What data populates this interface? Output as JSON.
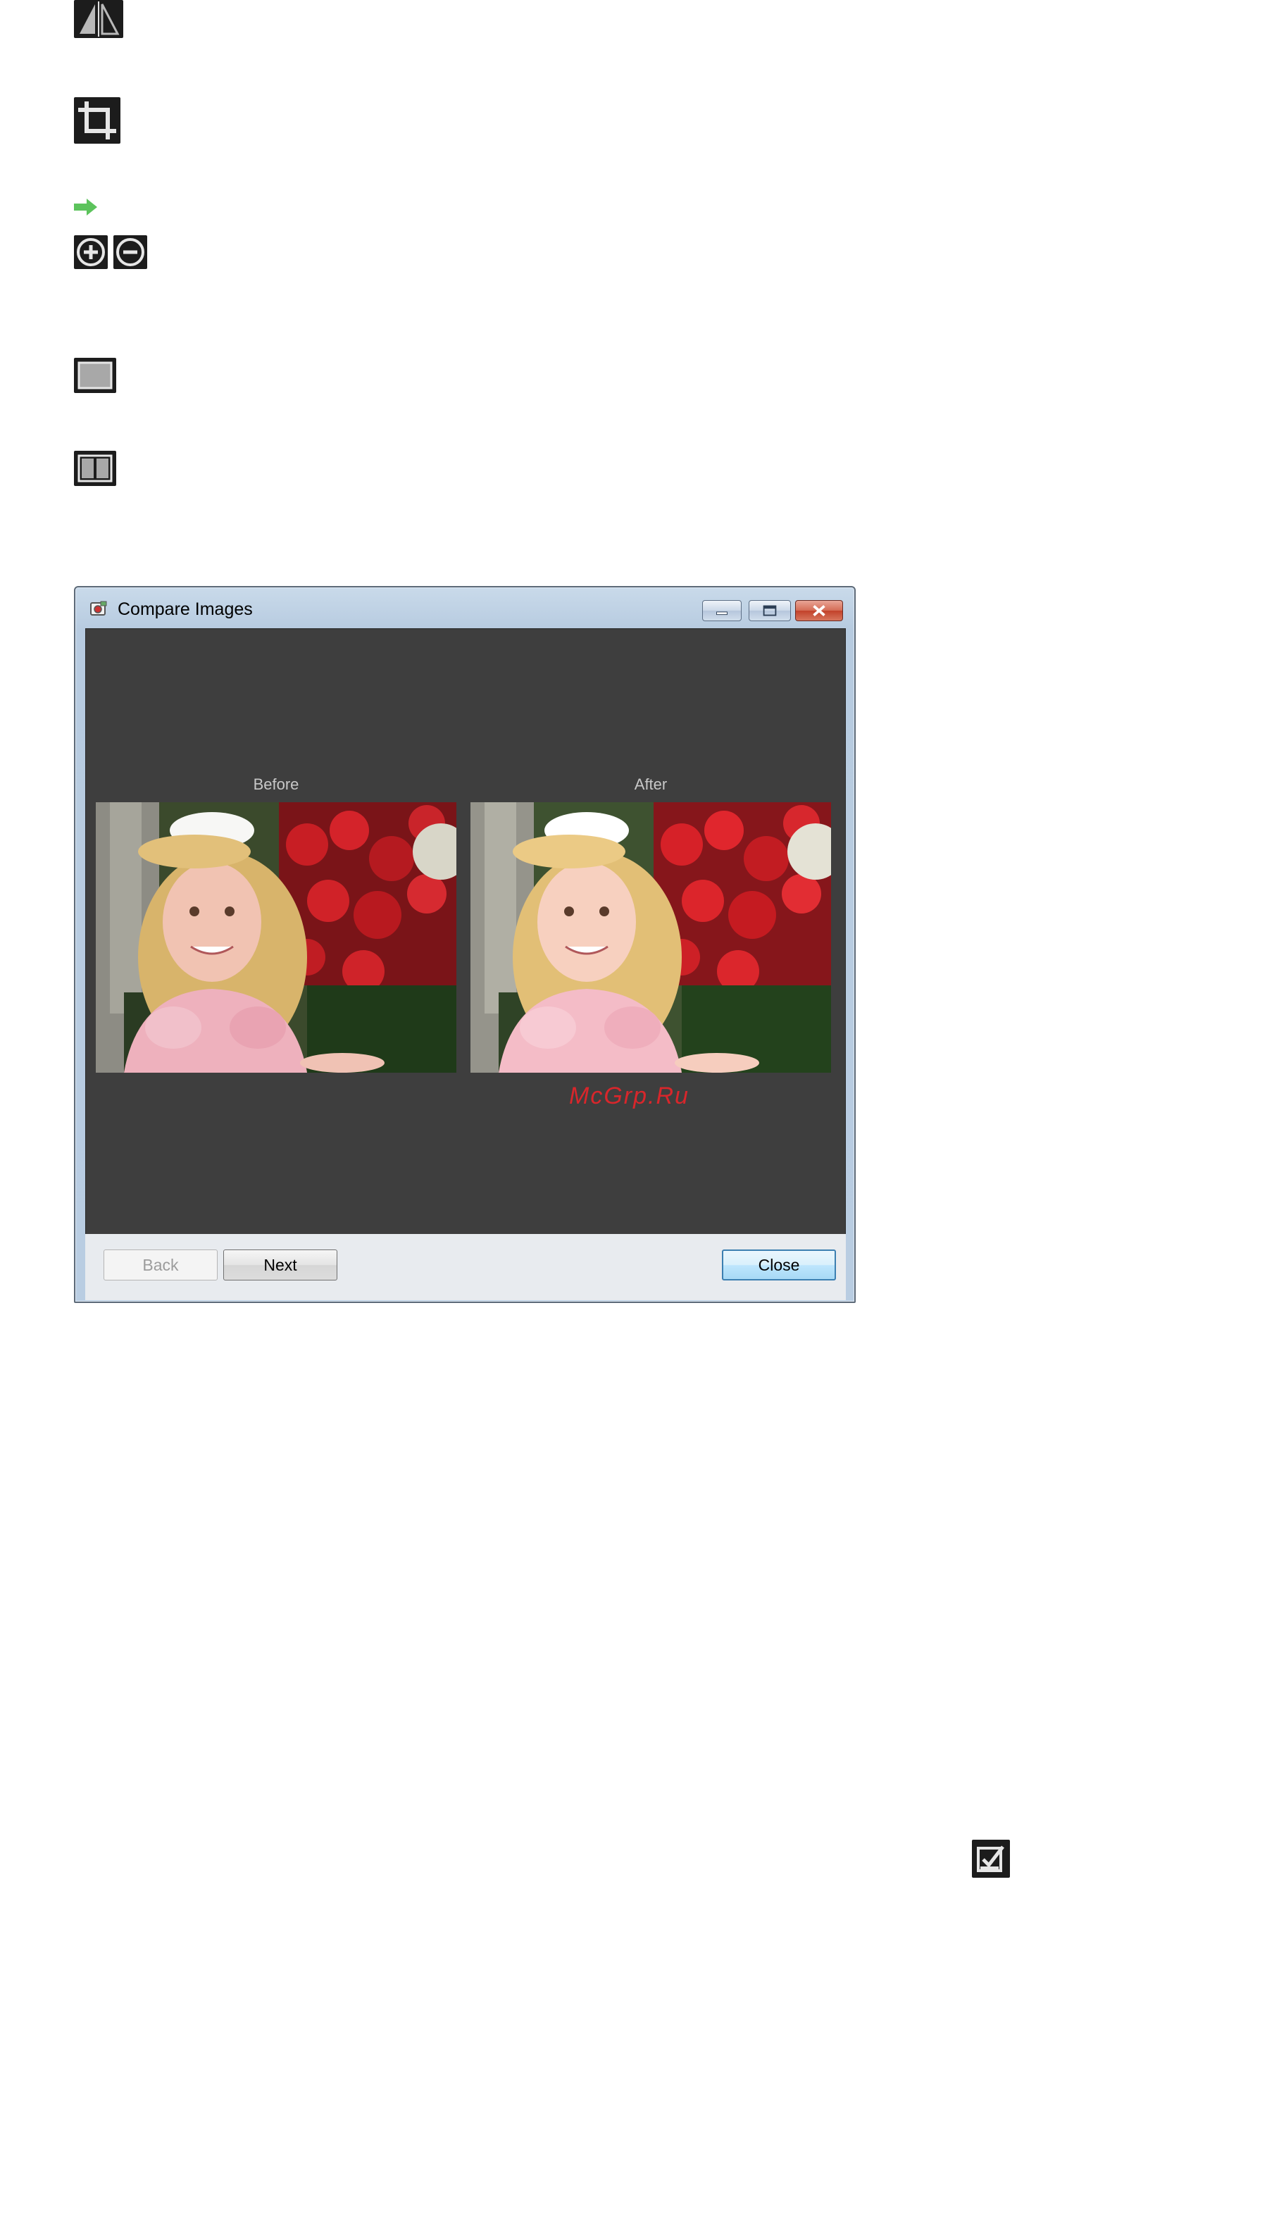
{
  "icons": {
    "flip": "flip-horizontal-icon",
    "crop": "crop-icon",
    "arrow": "green-arrow-icon",
    "zoom_in": "zoom-in-icon",
    "zoom_out": "zoom-out-icon",
    "single_view": "whole-image-view-icon",
    "compare_view": "compare-view-icon",
    "edit_check": "edit-checkbox-icon"
  },
  "window": {
    "title": "Compare Images",
    "app_icon": "app-icon",
    "controls": {
      "minimize": "minimize-icon",
      "maximize": "maximize-icon",
      "close": "close-icon"
    }
  },
  "preview": {
    "before_label": "Before",
    "after_label": "After",
    "watermark": "McGrp.Ru"
  },
  "buttons": {
    "back": "Back",
    "next": "Next",
    "close": "Close"
  },
  "colors": {
    "preview_bg": "#3e3e3e",
    "watermark": "#d8262b",
    "arrow": "#5cc35c"
  }
}
